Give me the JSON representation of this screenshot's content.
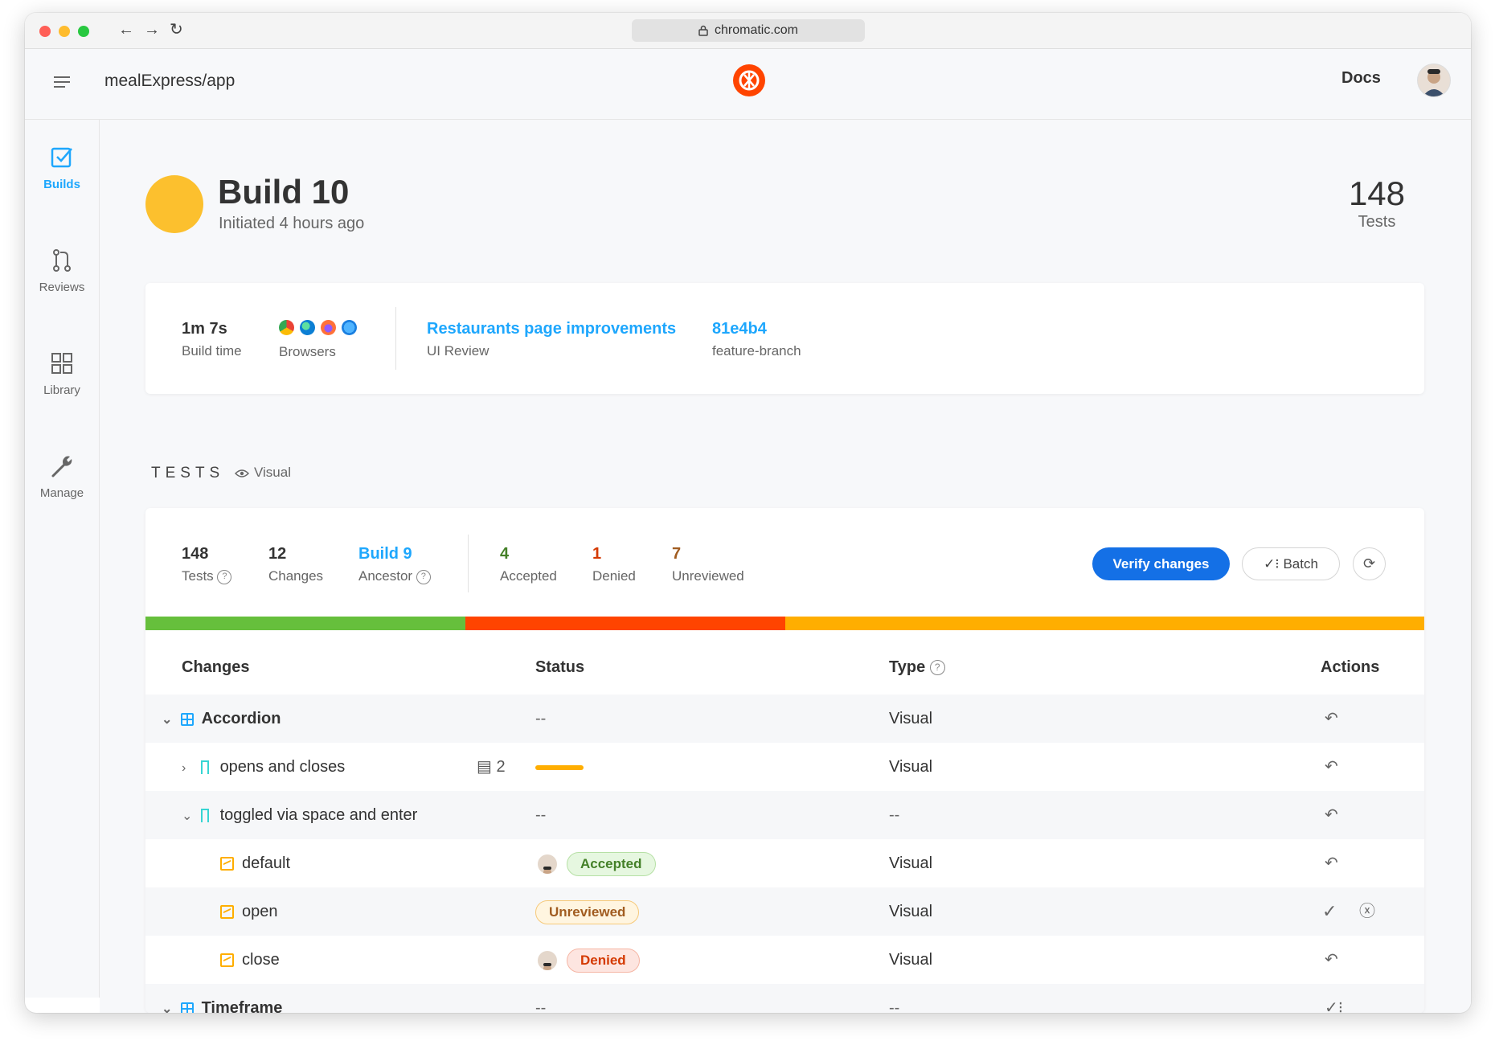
{
  "browser": {
    "url": "chromatic.com"
  },
  "header": {
    "repo": "mealExpress/app",
    "docs_label": "Docs"
  },
  "sidebar": {
    "items": [
      {
        "label": "Builds",
        "icon": "check-square-icon"
      },
      {
        "label": "Reviews",
        "icon": "pull-request-icon"
      },
      {
        "label": "Library",
        "icon": "grid-icon"
      },
      {
        "label": "Manage",
        "icon": "wrench-icon"
      }
    ]
  },
  "build": {
    "title": "Build 10",
    "subtitle": "Initiated 4 hours ago",
    "status_color": "#fcc02e",
    "tests_count": "148",
    "tests_label": "Tests"
  },
  "meta": {
    "build_time": "1m 7s",
    "build_time_label": "Build time",
    "browsers_label": "Browsers",
    "browsers": [
      "chrome",
      "edge",
      "firefox",
      "safari"
    ],
    "review_title": "Restaurants page improvements",
    "review_label": "UI Review",
    "commit": "81e4b4",
    "branch": "feature-branch"
  },
  "tests_section": {
    "heading": "TESTS",
    "filter": "Visual"
  },
  "summary": {
    "tests": "148",
    "tests_label": "Tests",
    "changes": "12",
    "changes_label": "Changes",
    "ancestor": "Build 9",
    "ancestor_label": "Ancestor",
    "accepted": "4",
    "accepted_label": "Accepted",
    "denied": "1",
    "denied_label": "Denied",
    "unreviewed": "7",
    "unreviewed_label": "Unreviewed",
    "verify_label": "Verify changes",
    "batch_label": "Batch"
  },
  "progress": [
    {
      "status": "accepted",
      "fraction": 0.25,
      "color": "#66bf3c"
    },
    {
      "status": "denied",
      "fraction": 0.25,
      "color": "#ff4400"
    },
    {
      "status": "unreviewed",
      "fraction": 0.5,
      "color": "#ffae00"
    }
  ],
  "table": {
    "headers": {
      "changes": "Changes",
      "status": "Status",
      "type": "Type",
      "actions": "Actions"
    },
    "rows": [
      {
        "name": "Accordion",
        "status": "--",
        "type": "Visual"
      },
      {
        "name": "opens and closes",
        "comments": "2",
        "type": "Visual"
      },
      {
        "name": "toggled via space and enter",
        "status": "--",
        "type": "--"
      },
      {
        "name": "default",
        "status": "Accepted",
        "type": "Visual"
      },
      {
        "name": "open",
        "status": "Unreviewed",
        "type": "Visual"
      },
      {
        "name": "close",
        "status": "Denied",
        "type": "Visual"
      },
      {
        "name": "Timeframe",
        "status": "--",
        "type": "--"
      }
    ]
  }
}
